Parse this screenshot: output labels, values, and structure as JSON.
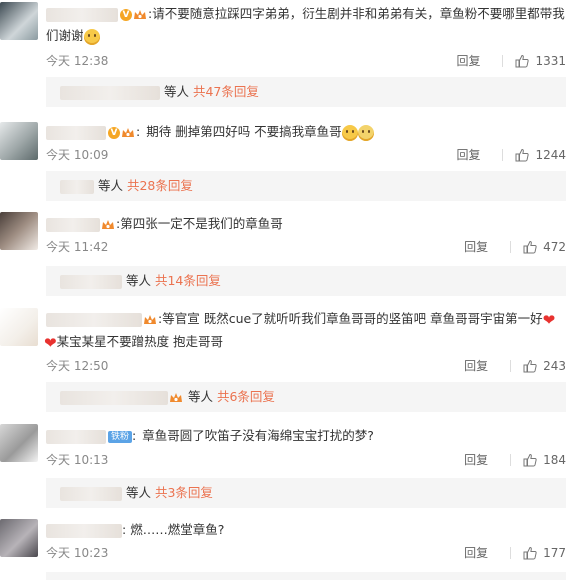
{
  "labels": {
    "reply": "回复",
    "people_suffix": "等人",
    "colon": ":"
  },
  "fan_badge": "铁粉",
  "comments": [
    {
      "text1": "请不要随意拉踩四字弟弟，衍生剧并非和弟弟有关，章鱼粉不要哪里都带我",
      "text2": "们谢谢",
      "time": "今天 12:38",
      "likes": "1331",
      "sub": "共47条回复"
    },
    {
      "text1": "期待 删掉第四好吗 不要搞我章鱼哥",
      "time": "今天 10:09",
      "likes": "1244",
      "sub": "共28条回复"
    },
    {
      "text1": "第四张一定不是我们的章鱼哥",
      "time": "今天 11:42",
      "likes": "472",
      "sub": "共14条回复"
    },
    {
      "text1": "等官宣 既然cue了就听听我们章鱼哥哥的竖笛吧 章鱼哥哥宇宙第一好",
      "text2": "某宝某星不要蹭热度 抱走哥哥",
      "time": "今天 12:50",
      "likes": "243",
      "sub": "共6条回复"
    },
    {
      "text1": "章鱼哥圆了吹笛子没有海绵宝宝打扰的梦?",
      "time": "今天 10:13",
      "likes": "184",
      "sub": "共3条回复"
    },
    {
      "text1": "燃……燃堂章鱼?",
      "time": "今天 10:23",
      "likes": "177"
    }
  ],
  "colors": {
    "accent": "#eb7350",
    "subbg": "#f5f5f5",
    "heart": "#e8322f"
  }
}
